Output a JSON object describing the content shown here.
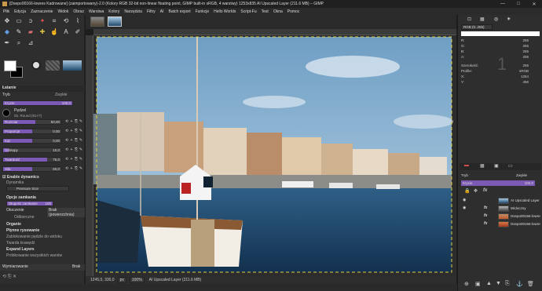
{
  "titlebar": {
    "title": "[Dsepo00166-lowres Kadrowane] (zaimportowany)-2.0 (Kolory RGB 32-bit non-linear floating point, GIMP built-in sRGB, 4 warstwy) 1253x835 AI Upscaled Layer (211.6 MB) – GIMP",
    "min": "—",
    "max": "□",
    "close": "✕"
  },
  "menu": [
    "Plik",
    "Edycja",
    "Zaznaczenie",
    "Widok",
    "Obraz",
    "Warstwa",
    "Kolory",
    "Narzędzia",
    "Filtry",
    "AI",
    "Batch export",
    "Funkcje",
    "Hello Worlds",
    "Script-Fu",
    "Test",
    "Okna",
    "Pomoc"
  ],
  "tooloptions": {
    "heading": "Łatanie",
    "mode_label": "Tryb",
    "mode_value": "Zwykłe",
    "opacity_label": "Krycie",
    "opacity_value": "100,0",
    "brush_label": "Pędzel",
    "brush_name": "02. Round (91×7)",
    "sliders": [
      {
        "label": "Rozmiar",
        "value": "50,00",
        "fill": 0.55
      },
      {
        "label": "Proporcje",
        "value": "0,00",
        "fill": 0.5
      },
      {
        "label": "Kąt",
        "value": "0,00",
        "fill": 0.5
      },
      {
        "label": "Odstępy",
        "value": "10,0",
        "fill": 0.1
      },
      {
        "label": "Twardość",
        "value": "75,0",
        "fill": 0.75
      },
      {
        "label": "Siła",
        "value": "50,0",
        "fill": 0.5
      }
    ],
    "dynamics_label": "Enable dynamics",
    "dynamics_label2": "Dynamika",
    "dynamics_value": "Pressure Size",
    "sampling_label": "Opcje zamkania",
    "sample_label": "Długość zamkanie",
    "sample_value": "100",
    "source_label": "Otoczenie",
    "source_value": "Brak (powierzchnia)",
    "align_label": "Odbiorczne",
    "inc1": "Organie",
    "inc2": "Płynne rysowanie",
    "inc3": "Zablokowanie pędzle do widoku",
    "inc4": "Twarda krawędź",
    "expand": "Expand Layers",
    "expand2": "Próbkowanie wszystkich warstw",
    "bottom_label": "Wymiarowanie",
    "bottom_value": "Brak"
  },
  "status": {
    "coords": "1245,0, 330,0",
    "unit": "px",
    "zoom": "100%",
    "layer": "AI Upscaled Layer (211.6 MB)"
  },
  "pointer": {
    "mode": "RGB (0..255)",
    "rows": [
      {
        "k": "R:",
        "v": "255"
      },
      {
        "k": "G:",
        "v": "255"
      },
      {
        "k": "B:",
        "v": "255"
      },
      {
        "k": "A:",
        "v": "255"
      }
    ],
    "rows2": [
      {
        "k": "Szerokość:",
        "v": "255"
      },
      {
        "k": "Profile:",
        "v": "sRGB"
      },
      {
        "k": "X:",
        "v": "1254"
      },
      {
        "k": "Y:",
        "v": "456"
      }
    ],
    "big": "1"
  },
  "layers": {
    "mode_label": "Tryb",
    "mode_value": "Zwykłe",
    "opacity_label": "Krycie",
    "opacity_value": "100,0",
    "items": [
      {
        "name": "AI Upscaled Layer",
        "fx": false
      },
      {
        "name": "Widoczny",
        "fx": true
      },
      {
        "name": "Dsepo00166-lowres K...",
        "fx": true
      },
      {
        "name": "Dsepo00166-lowres K...",
        "fx": true
      }
    ]
  },
  "colors": {
    "accent": "#7b59b5",
    "sky": "#a9c8e0",
    "sea": "#20496e"
  }
}
